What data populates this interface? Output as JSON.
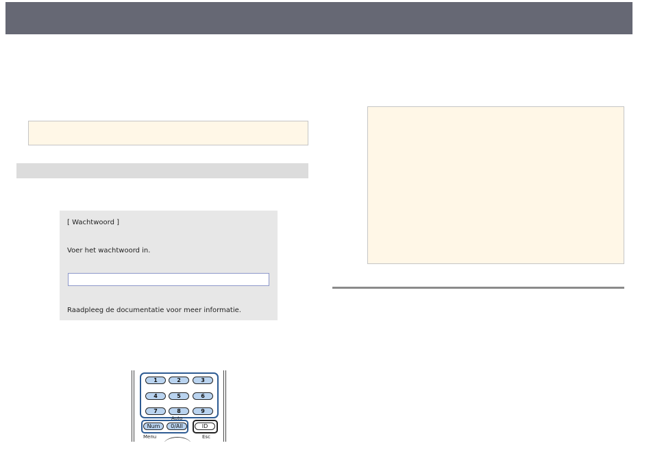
{
  "password_screen": {
    "title": "[ Wachtwoord ]",
    "prompt": "Voer het wachtwoord in.",
    "input_value": "",
    "hint": "Raadpleeg de documentatie voor meer informatie."
  },
  "remote": {
    "keys": [
      "1",
      "2",
      "3",
      "4",
      "5",
      "6",
      "7",
      "8",
      "9"
    ],
    "num_key": "Num",
    "zero_key": "0/All",
    "id_key": "ID",
    "auto_label": "Auto",
    "menu_label": "Menu",
    "esc_label": "Esc"
  },
  "colors": {
    "header_bar": "#666874",
    "note_fill": "#fff7e7",
    "section_bar": "#dcdcdc",
    "key_fill": "#b9d3ef",
    "key_outline": "#2d5b92"
  }
}
